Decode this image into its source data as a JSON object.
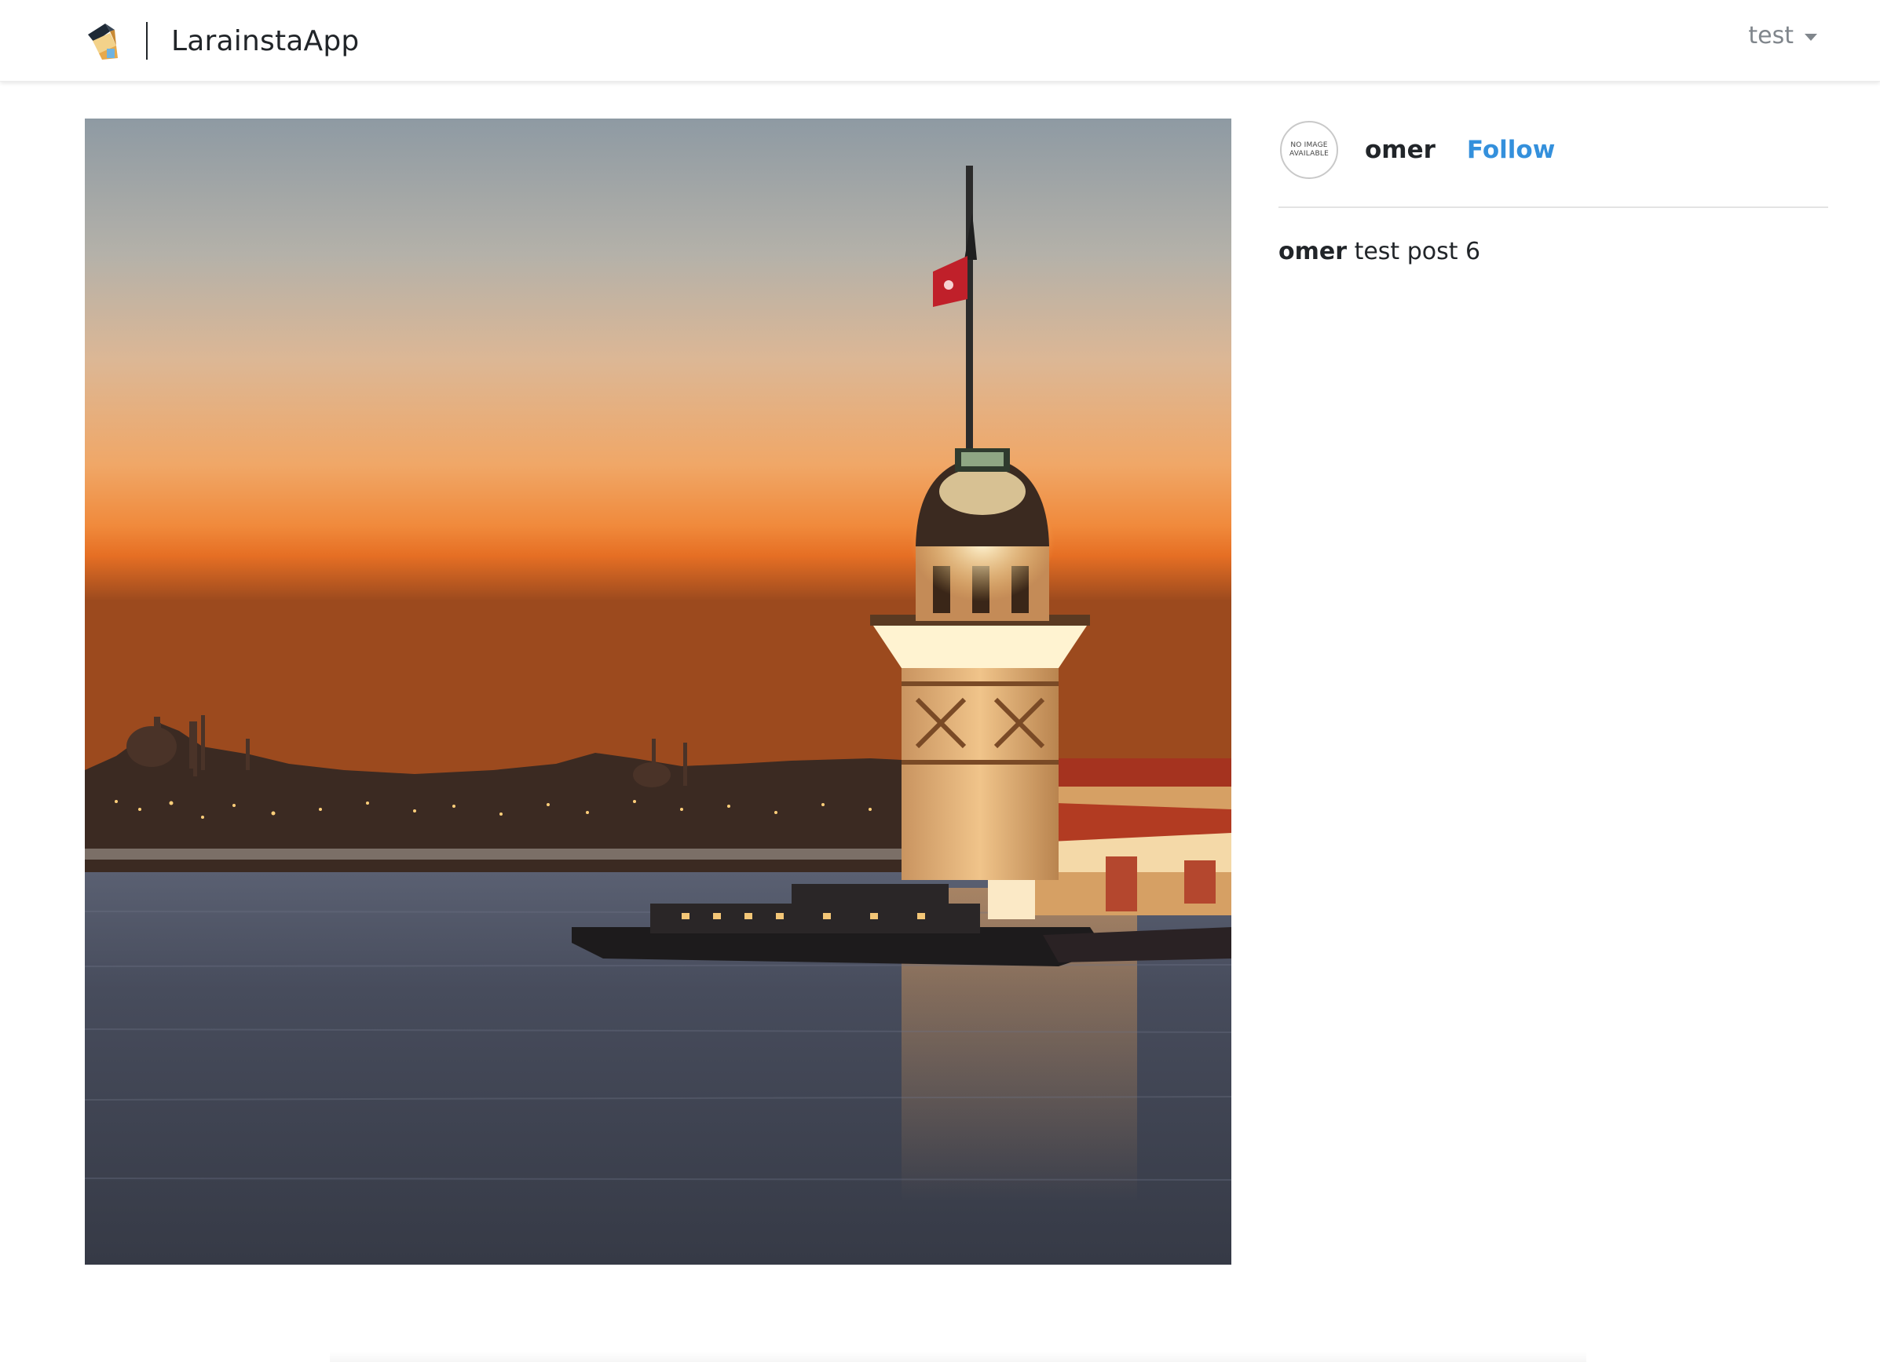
{
  "app": {
    "brand_name": "LarainstaApp",
    "logo_icon": "larainsta-logo-icon"
  },
  "user_menu": {
    "username": "test",
    "caret_icon": "caret-down-icon"
  },
  "post": {
    "image_alt": "Maiden's Tower at sunset over the Bosphorus",
    "author": {
      "avatar_text_line1": "NO IMAGE",
      "avatar_text_line2": "AVAILABLE",
      "username": "omer",
      "follow_label": "Follow"
    },
    "caption": {
      "author": "omer",
      "text": "test post 6"
    }
  },
  "colors": {
    "link_blue": "#3490dc",
    "text": "#212529",
    "muted": "#80868c"
  }
}
